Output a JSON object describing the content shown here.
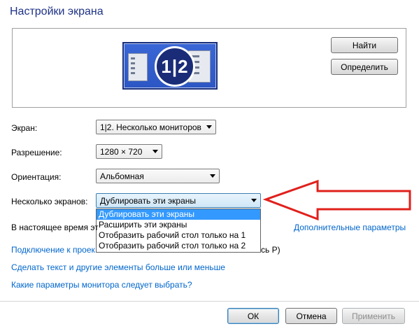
{
  "window": {
    "title": "Настройки экрана"
  },
  "preview": {
    "badge": "1|2"
  },
  "buttons": {
    "find": "Найти",
    "identify": "Определить",
    "ok": "ОК",
    "cancel": "Отмена",
    "apply": "Применить"
  },
  "fields": {
    "display": {
      "label": "Экран:",
      "value": "1|2. Несколько мониторов"
    },
    "resolution": {
      "label": "Разрешение:",
      "value": "1280 × 720"
    },
    "orientation": {
      "label": "Ориентация:",
      "value": "Альбомная"
    },
    "multiple": {
      "label": "Несколько экранов:",
      "value": "Дублировать эти экраны"
    }
  },
  "dropdown": {
    "options": [
      "Дублировать эти экраны",
      "Расширить эти экраны",
      "Отобразить рабочий стол только на 1",
      "Отобразить рабочий стол только на 2"
    ],
    "selected_index": 0
  },
  "info": {
    "current_partial": "В настоящее время эт",
    "advanced_link": "Дополнительные параметры"
  },
  "links": {
    "connect_partial": "Подключение к проек",
    "connect_tail": "сь P)",
    "text_size": "Сделать текст и другие элементы больше или меньше",
    "which_settings": "Какие параметры монитора следует выбрать?"
  },
  "colors": {
    "title": "#1e3287",
    "link": "#0066cc",
    "selection": "#3399ff",
    "arrow_stroke": "#e0201c"
  }
}
